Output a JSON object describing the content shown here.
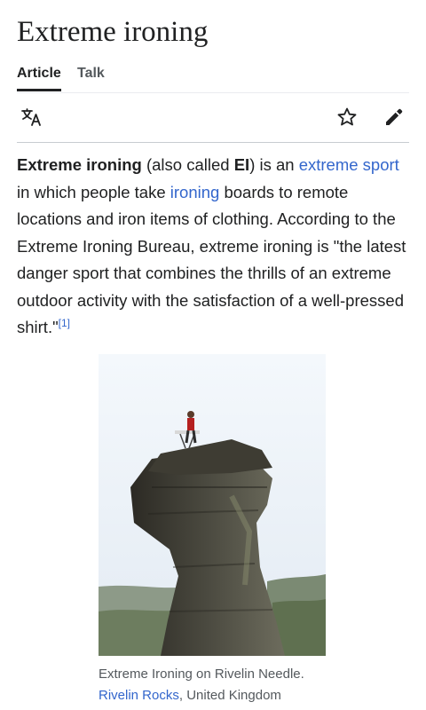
{
  "article": {
    "title": "Extreme ironing"
  },
  "tabs": [
    {
      "label": "Article",
      "active": true
    },
    {
      "label": "Talk",
      "active": false
    }
  ],
  "toolbar": {
    "language_icon": "translate-icon",
    "watch_icon": "star-outline-icon",
    "edit_icon": "pencil-icon"
  },
  "intro": {
    "term": "Extreme ironing",
    "t1": " (also called ",
    "abbr": "EI",
    "t2": ") is an ",
    "link_sport": "extreme sport",
    "t3": " in which people take ",
    "link_ironing": "ironing",
    "t4": " boards to remote locations and iron items of clothing. According to the Extreme Ironing Bureau, extreme ironing is \"the latest danger sport that combines the thrills of an extreme outdoor activity with the satisfaction of a well-pressed shirt.\"",
    "ref": "[1]"
  },
  "figure": {
    "caption_text": "Extreme Ironing on Rivelin Needle.",
    "caption_link": "Rivelin Rocks",
    "caption_rest": ", United Kingdom"
  },
  "colors": {
    "link": "#3366cc",
    "text": "#202122",
    "muted": "#54595d",
    "divider": "#c8ccd1"
  }
}
